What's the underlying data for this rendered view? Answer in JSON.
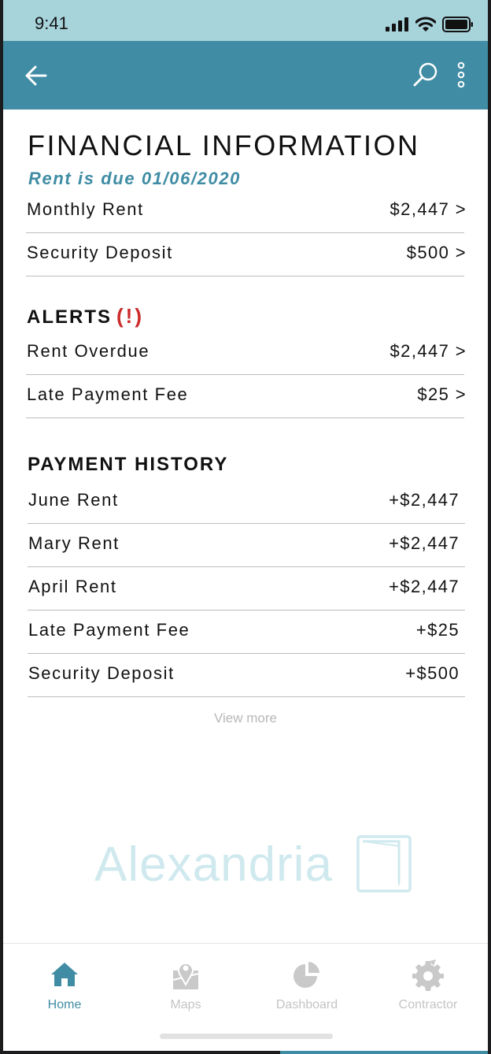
{
  "status_bar": {
    "time": "9:41"
  },
  "colors": {
    "accent": "#3f8ca4",
    "status_bar": "#a7d3db",
    "alert": "#cc2b2b"
  },
  "app_bar": {
    "back_icon": "arrow-left-icon",
    "search_icon": "search-icon",
    "more_icon": "more-vertical-icon"
  },
  "page": {
    "title": "FINANCIAL INFORMATION",
    "due_text": "Rent is due 01/06/2020"
  },
  "financial": [
    {
      "label": "Monthly Rent",
      "value": "$2,447 >"
    },
    {
      "label": "Security Deposit",
      "value": "$500 >"
    }
  ],
  "alerts": {
    "title": "ALERTS",
    "mark": "(!)",
    "items": [
      {
        "label": "Rent Overdue",
        "value": "$2,447 >"
      },
      {
        "label": "Late Payment Fee",
        "value": "$25 >"
      }
    ]
  },
  "history": {
    "title": "PAYMENT HISTORY",
    "items": [
      {
        "label": "June Rent",
        "value": "+$2,447"
      },
      {
        "label": "Mary Rent",
        "value": "+$2,447"
      },
      {
        "label": "April Rent",
        "value": "+$2,447"
      },
      {
        "label": "Late Payment Fee",
        "value": "+$25"
      },
      {
        "label": "Security Deposit",
        "value": "+$500"
      }
    ],
    "view_more": "View more"
  },
  "brand": {
    "name": "Alexandria",
    "icon": "book-logo-icon"
  },
  "tabs": [
    {
      "label": "Home",
      "icon": "home-icon",
      "active": true
    },
    {
      "label": "Maps",
      "icon": "map-pin-icon",
      "active": false
    },
    {
      "label": "Dashboard",
      "icon": "pie-chart-icon",
      "active": false
    },
    {
      "label": "Contractor",
      "icon": "gear-icon",
      "active": false
    }
  ]
}
